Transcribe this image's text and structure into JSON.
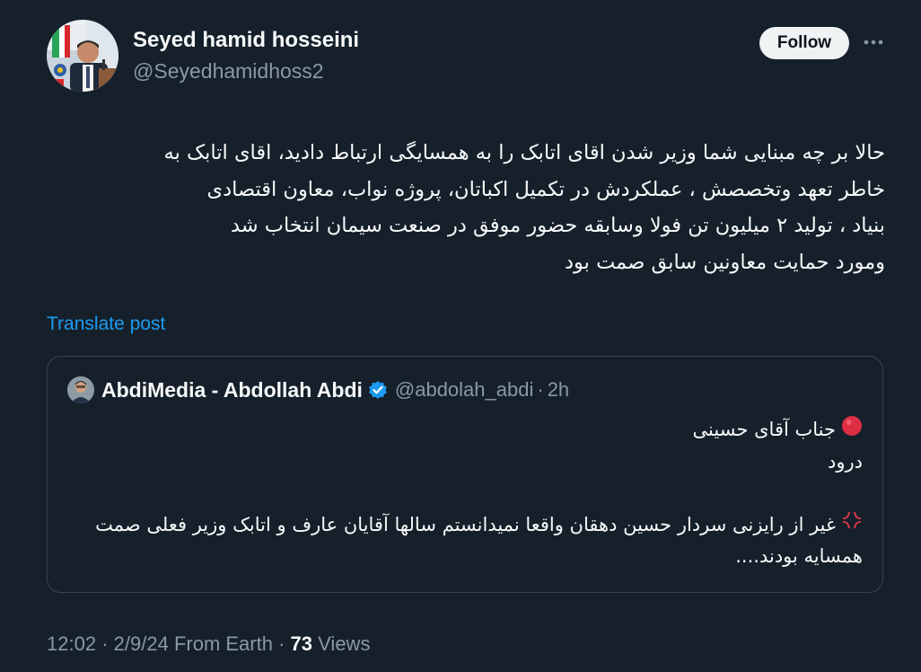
{
  "author": {
    "display_name": "Seyed hamid hosseini",
    "handle": "@Seyedhamidhoss2",
    "avatar_icon": "profile-photo"
  },
  "actions": {
    "follow_label": "Follow",
    "more_icon": "ellipsis-icon"
  },
  "post": {
    "lines": [
      "حالا بر چه مبنایی شما وزیر شدن اقای اتابک را به همسایگی ارتباط دادید، اقای اتابک به",
      "خاطر تعهد وتخصصش ، عملکردش در تکمیل اکباتان، پروژه نواب، معاون اقتصادی",
      "بنیاد ، تولید ۲ میلیون تن فولا وسابقه حضور موفق در صنعت سیمان انتخاب شد",
      "ومورد حمایت معاونین سابق صمت بود"
    ],
    "translate_label": "Translate post"
  },
  "quoted_post": {
    "display_name": "AbdiMedia - Abdollah Abdi",
    "verified": true,
    "handle": "@abdolah_abdi",
    "separator": "·",
    "time": "2h",
    "lines": [
      "جناب آقای حسینی",
      "درود",
      "",
      "غیر از رایزنی سردار حسین دهقان واقعا نمیدانستم سالها آقایان عارف و اتابک وزیر فعلی صمت همسایه بودند...."
    ],
    "emoji_icons": [
      "red-circle-emoji",
      "anger-symbol-emoji"
    ]
  },
  "meta": {
    "time": "12:02",
    "separator": "·",
    "date": "2/9/24",
    "source": "From Earth",
    "views_count": "73",
    "views_label": "Views"
  },
  "colors": {
    "background": "#15202b",
    "text_primary": "#f7f9f9",
    "text_secondary": "#8b98a5",
    "accent": "#1d9bf0",
    "border": "#38444d",
    "button_bg": "#eff3f4"
  }
}
